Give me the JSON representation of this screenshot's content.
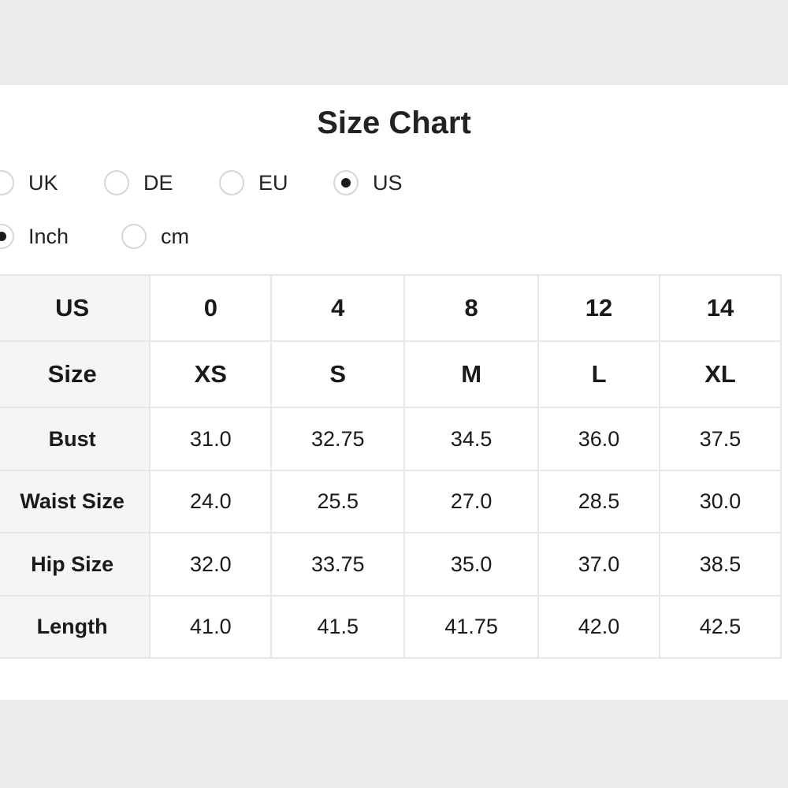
{
  "title": "Size Chart",
  "region_options": [
    {
      "label": "UK",
      "checked": false
    },
    {
      "label": "DE",
      "checked": false
    },
    {
      "label": "EU",
      "checked": false
    },
    {
      "label": "US",
      "checked": true
    }
  ],
  "unit_options": [
    {
      "label": "Inch",
      "checked": true
    },
    {
      "label": "cm",
      "checked": false
    }
  ],
  "table": {
    "rows": [
      {
        "label": "US",
        "cells": [
          "0",
          "4",
          "8",
          "12",
          "14"
        ]
      },
      {
        "label": "Size",
        "cells": [
          "XS",
          "S",
          "M",
          "L",
          "XL"
        ]
      },
      {
        "label": "Bust",
        "cells": [
          "31.0",
          "32.75",
          "34.5",
          "36.0",
          "37.5"
        ]
      },
      {
        "label": "Waist Size",
        "cells": [
          "24.0",
          "25.5",
          "27.0",
          "28.5",
          "30.0"
        ]
      },
      {
        "label": "Hip Size",
        "cells": [
          "32.0",
          "33.75",
          "35.0",
          "37.0",
          "38.5"
        ]
      },
      {
        "label": "Length",
        "cells": [
          "41.0",
          "41.5",
          "41.75",
          "42.0",
          "42.5"
        ]
      }
    ]
  }
}
